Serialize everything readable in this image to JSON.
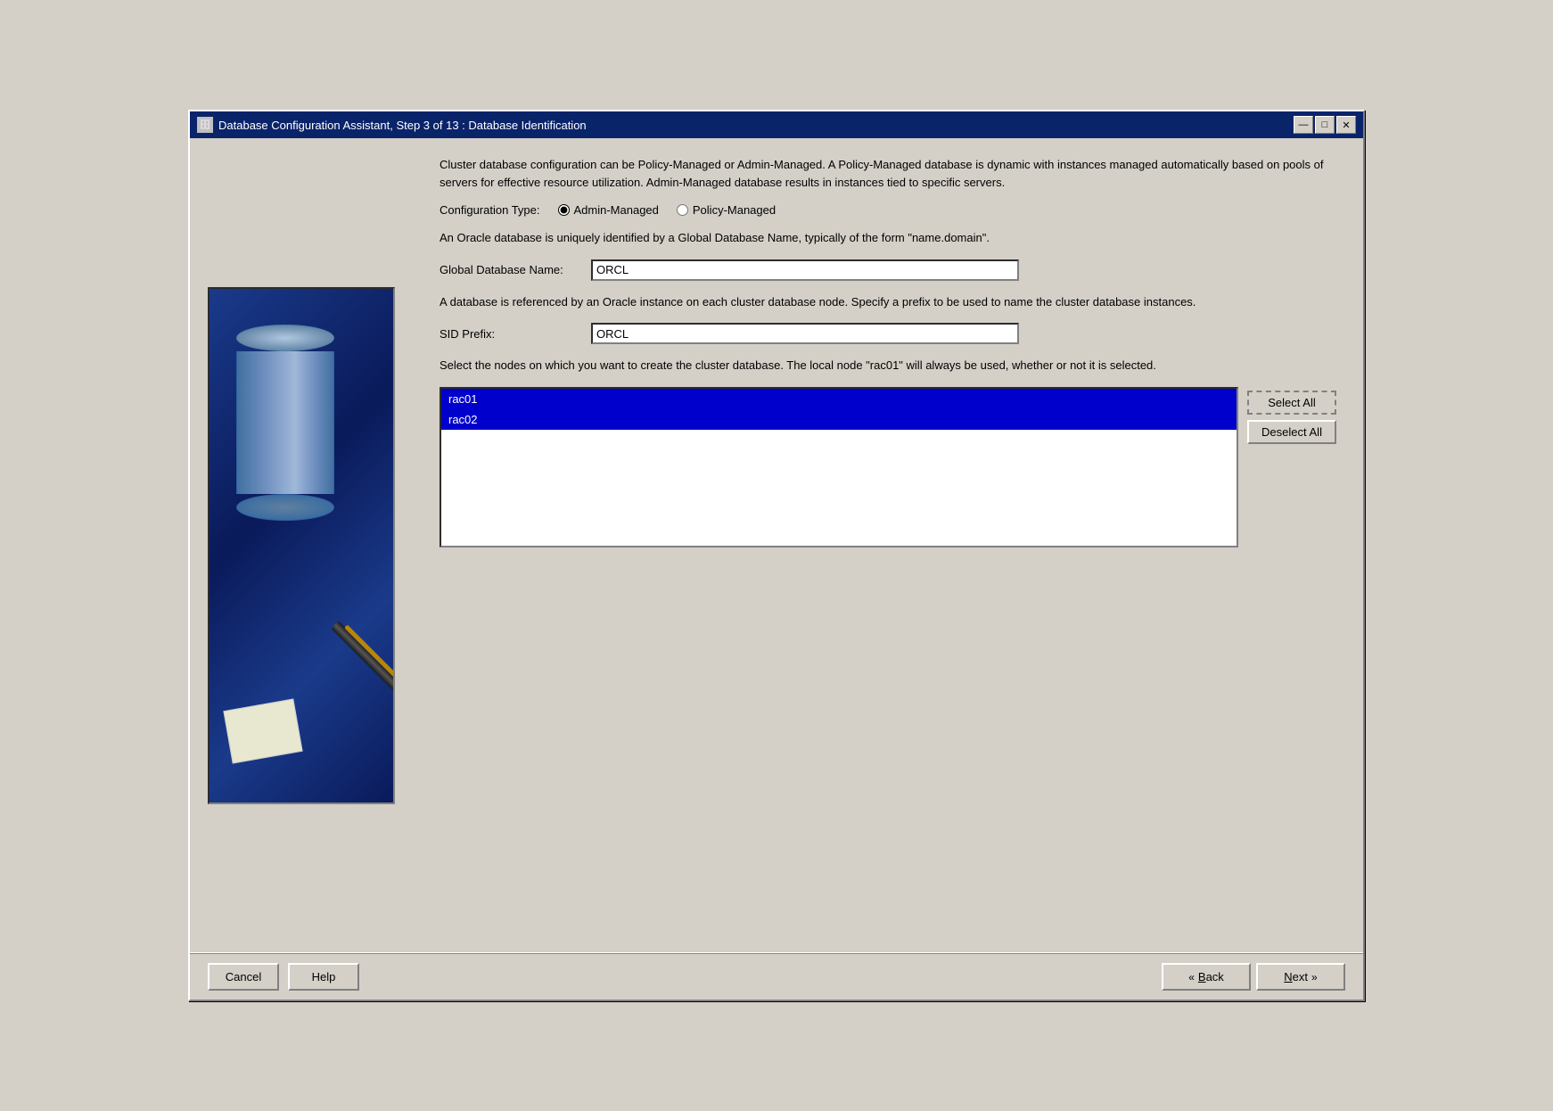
{
  "window": {
    "title": "Database Configuration Assistant, Step 3 of 13 : Database Identification",
    "icon": "🗄️"
  },
  "title_buttons": {
    "minimize": "—",
    "maximize": "□",
    "close": "✕"
  },
  "description": "Cluster database configuration can be Policy-Managed or Admin-Managed. A Policy-Managed database is dynamic with instances managed automatically based on pools of servers for effective resource utilization. Admin-Managed database results in instances tied to specific servers.",
  "config_type": {
    "label": "Configuration Type:",
    "options": [
      "Admin-Managed",
      "Policy-Managed"
    ],
    "selected": "Admin-Managed"
  },
  "global_db_info": "An Oracle database is uniquely identified by a Global Database Name, typically of the form \"name.domain\".",
  "global_db_name": {
    "label": "Global Database Name:",
    "value": "ORCL"
  },
  "sid_info": "A database is referenced by an Oracle instance on each cluster database node. Specify a prefix to be used to name the cluster database instances.",
  "sid_prefix": {
    "label": "SID Prefix:",
    "value": "ORCL"
  },
  "nodes_description": "Select the nodes on which you want to create the cluster database. The local node \"rac01\" will always be used, whether or not it is selected.",
  "nodes": {
    "items": [
      {
        "name": "rac01",
        "selected": true
      },
      {
        "name": "rac02",
        "selected": true
      }
    ]
  },
  "buttons": {
    "select_all": "Select All",
    "deselect_all": "Deselect All"
  },
  "footer": {
    "cancel": "Cancel",
    "help": "Help",
    "back": "Back",
    "next": "Next"
  }
}
